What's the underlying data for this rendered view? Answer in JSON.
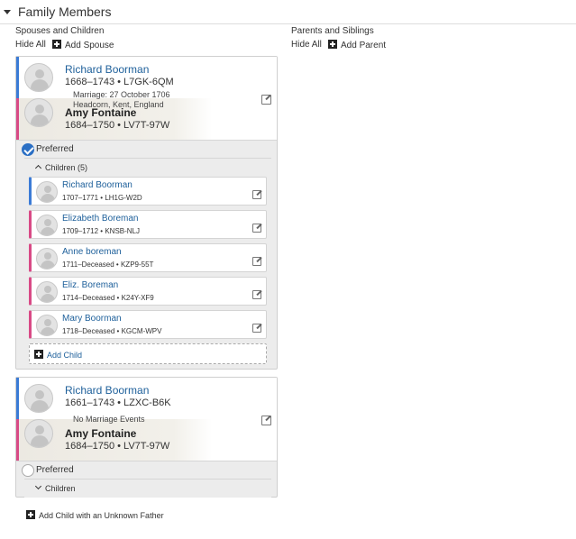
{
  "section_title": "Family Members",
  "left_column": {
    "heading": "Spouses and Children",
    "hide_all": "Hide All",
    "add_spouse": "Add Spouse"
  },
  "right_column": {
    "heading": "Parents and Siblings",
    "hide_all": "Hide All",
    "add_parent": "Add Parent"
  },
  "families": [
    {
      "husband": {
        "name": "Richard Boorman",
        "lifespan": "1668–1743",
        "pid": "L7GK-6QM"
      },
      "marriage_line1": "Marriage: 27 October 1706",
      "marriage_line2": "Headcorn, Kent, England",
      "wife": {
        "name": "Amy Fontaine",
        "lifespan": "1684–1750",
        "pid": "LV7T-97W"
      },
      "preferred_label": "Preferred",
      "children_label": "Children (5)",
      "children": [
        {
          "name": "Richard Boorman",
          "lifespan": "1707–1771",
          "pid": "LH1G-W2D"
        },
        {
          "name": "Elizabeth Boreman",
          "lifespan": "1709–1712",
          "pid": "KNSB-NLJ"
        },
        {
          "name": "Anne boreman",
          "lifespan": "1711–Deceased",
          "pid": "KZP9-55T"
        },
        {
          "name": "Eliz. Boreman",
          "lifespan": "1714–Deceased",
          "pid": "K24Y-XF9"
        },
        {
          "name": "Mary Boorman",
          "lifespan": "1718–Deceased",
          "pid": "KGCM-WPV"
        }
      ],
      "add_child": "Add Child"
    },
    {
      "husband": {
        "name": "Richard Boorman",
        "lifespan": "1661–1743",
        "pid": "LZXC-B6K"
      },
      "marriage_line1": "No Marriage Events",
      "wife": {
        "name": "Amy Fontaine",
        "lifespan": "1684–1750",
        "pid": "LV7T-97W"
      },
      "preferred_label": "Preferred",
      "children_label": "Children"
    }
  ],
  "add_child_unknown_father": "Add Child with an Unknown Father",
  "separator": "•",
  "colors": {
    "male": "#3b7bd6",
    "female": "#d84a86",
    "link": "#1d5f9a",
    "preferred": "#2b6fc4"
  }
}
